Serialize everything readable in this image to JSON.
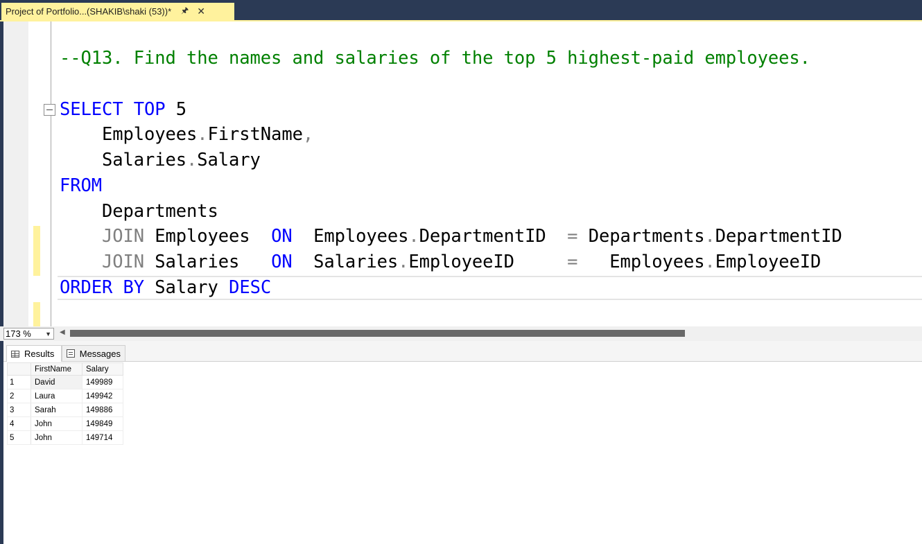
{
  "window": {
    "tab_title": "Project of Portfolio...(SHAKIB\\shaki (53))*",
    "pin_icon": "pin-icon",
    "close_icon": "close-icon"
  },
  "editor": {
    "lines": [
      {
        "tokens": [
          {
            "t": "--Q13. Find the names and salaries of the top 5 highest-paid employees.",
            "c": "cm"
          }
        ]
      },
      {
        "tokens": [
          {
            "t": "SELECT",
            "c": "kw"
          },
          {
            "t": " "
          },
          {
            "t": "TOP",
            "c": "kw"
          },
          {
            "t": " 5"
          }
        ]
      },
      {
        "tokens": [
          {
            "t": "    Employees"
          },
          {
            "t": ".",
            "c": "op"
          },
          {
            "t": "FirstName"
          },
          {
            "t": ",",
            "c": "op"
          }
        ]
      },
      {
        "tokens": [
          {
            "t": "    Salaries"
          },
          {
            "t": ".",
            "c": "op"
          },
          {
            "t": "Salary"
          }
        ]
      },
      {
        "tokens": [
          {
            "t": "FROM",
            "c": "kw"
          }
        ]
      },
      {
        "tokens": [
          {
            "t": "    Departments"
          }
        ]
      },
      {
        "tokens": [
          {
            "t": "    "
          },
          {
            "t": "JOIN",
            "c": "gr"
          },
          {
            "t": " Employees  "
          },
          {
            "t": "ON",
            "c": "kw"
          },
          {
            "t": "  Employees"
          },
          {
            "t": ".",
            "c": "op"
          },
          {
            "t": "DepartmentID  "
          },
          {
            "t": "=",
            "c": "op"
          },
          {
            "t": " Departments"
          },
          {
            "t": ".",
            "c": "op"
          },
          {
            "t": "DepartmentID"
          }
        ]
      },
      {
        "tokens": [
          {
            "t": "    "
          },
          {
            "t": "JOIN",
            "c": "gr"
          },
          {
            "t": " Salaries   "
          },
          {
            "t": "ON",
            "c": "kw"
          },
          {
            "t": "  Salaries"
          },
          {
            "t": ".",
            "c": "op"
          },
          {
            "t": "EmployeeID     "
          },
          {
            "t": "=",
            "c": "op"
          },
          {
            "t": "   Employees"
          },
          {
            "t": ".",
            "c": "op"
          },
          {
            "t": "EmployeeID"
          }
        ]
      },
      {
        "tokens": [
          {
            "t": "ORDER",
            "c": "kw"
          },
          {
            "t": " "
          },
          {
            "t": "BY",
            "c": "kw"
          },
          {
            "t": " Salary "
          },
          {
            "t": "DESC",
            "c": "kw"
          }
        ]
      }
    ]
  },
  "zoom": {
    "value": "173 %"
  },
  "results": {
    "tabs": [
      {
        "label": "Results",
        "icon": "grid-icon"
      },
      {
        "label": "Messages",
        "icon": "messages-icon"
      }
    ],
    "columns": [
      "FirstName",
      "Salary"
    ],
    "rows": [
      {
        "num": "1",
        "FirstName": "David",
        "Salary": "149989"
      },
      {
        "num": "2",
        "FirstName": "Laura",
        "Salary": "149942"
      },
      {
        "num": "3",
        "FirstName": "Sarah",
        "Salary": "149886"
      },
      {
        "num": "4",
        "FirstName": "John",
        "Salary": "149849"
      },
      {
        "num": "5",
        "FirstName": "John",
        "Salary": "149714"
      }
    ]
  },
  "colors": {
    "title_bar": "#2b3a55",
    "active_tab": "#fff29d",
    "keyword": "#0000ff",
    "comment": "#008000",
    "operator": "#808080"
  }
}
